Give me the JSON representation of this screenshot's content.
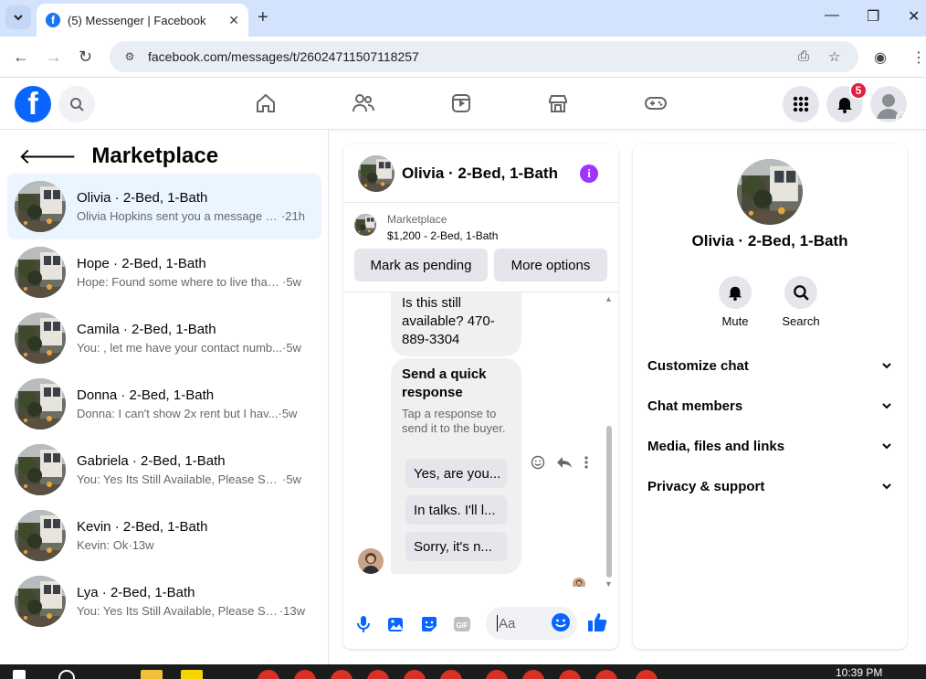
{
  "browser": {
    "tab_title": "(5) Messenger | Facebook",
    "url": "facebook.com/messages/t/26024711507118257"
  },
  "header": {
    "notification_count": "5"
  },
  "left_panel": {
    "title": "Marketplace",
    "conversations": [
      {
        "name": "Olivia · 2-Bed, 1-Bath",
        "snippet": "Olivia Hopkins sent you a message a...",
        "time": "·21h",
        "active": true
      },
      {
        "name": "Hope · 2-Bed, 1-Bath",
        "snippet": "Hope: Found some where to live than...",
        "time": "·5w"
      },
      {
        "name": "Camila · 2-Bed, 1-Bath",
        "snippet": "You: , let me have your contact numb...",
        "time": "·5w"
      },
      {
        "name": "Donna · 2-Bed, 1-Bath",
        "snippet": "Donna: I can't show 2x rent but I hav...",
        "time": "·5w"
      },
      {
        "name": "Gabriela · 2-Bed, 1-Bath",
        "snippet": "You: Yes Its Still Available, Please Send...",
        "time": "·5w"
      },
      {
        "name": "Kevin · 2-Bed, 1-Bath",
        "snippet": "Kevin: Ok",
        "time": "·13w"
      },
      {
        "name": "Lya · 2-Bed, 1-Bath",
        "snippet": "You: Yes Its Still Available, Please Sen...",
        "time": "·13w"
      }
    ]
  },
  "chat": {
    "title": "Olivia · 2-Bed, 1-Bath",
    "listing_category": "Marketplace",
    "listing_price": "$1,200 - 2-Bed, 1-Bath",
    "mark_pending_label": "Mark as pending",
    "more_options_label": "More options",
    "message_1": "Is this still available? 470-889-3304",
    "quick_title": "Send a quick response",
    "quick_subtitle": "Tap a response to send it to the buyer.",
    "quick_replies": [
      "Yes, are you...",
      "In talks. I'll l...",
      "Sorry, it's n..."
    ],
    "composer_placeholder": "Aa"
  },
  "details": {
    "name": "Olivia · 2-Bed, 1-Bath",
    "mute_label": "Mute",
    "search_label": "Search",
    "sections": [
      "Customize chat",
      "Chat members",
      "Media, files and links",
      "Privacy & support"
    ]
  },
  "taskbar": {
    "time": "10:39 PM"
  },
  "colors": {
    "fb_blue": "#0866ff",
    "active_row": "#ebf5ff",
    "info_purple": "#a033ff",
    "badge_red": "#e41e3f"
  }
}
